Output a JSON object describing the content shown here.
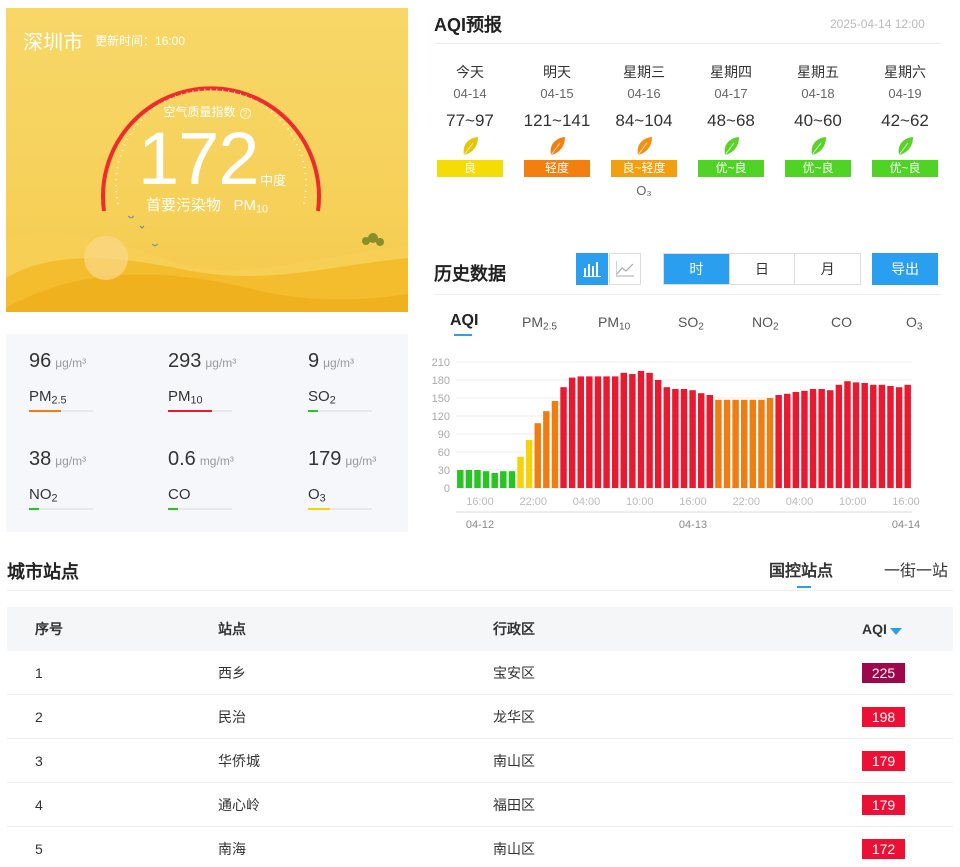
{
  "hero": {
    "city": "深圳市",
    "update_label": "更新时间：16:00",
    "aqi_label": "空气质量指数",
    "aqi_value": "172",
    "level": "中度",
    "primary_label": "首要污染物",
    "primary_pollutant": "PM",
    "primary_pollutant_sub": "10"
  },
  "pollutants": [
    {
      "value": "96",
      "unit": "μg/m³",
      "name": "PM",
      "sub": "2.5",
      "color": "#f07d12"
    },
    {
      "value": "293",
      "unit": "μg/m³",
      "name": "PM",
      "sub": "10",
      "color": "#e9192f"
    },
    {
      "value": "9",
      "unit": "μg/m³",
      "name": "SO",
      "sub": "2",
      "color": "#27c521"
    },
    {
      "value": "38",
      "unit": "μg/m³",
      "name": "NO",
      "sub": "2",
      "color": "#27c521"
    },
    {
      "value": "0.6",
      "unit": "mg/m³",
      "name": "CO",
      "sub": "",
      "color": "#27c521"
    },
    {
      "value": "179",
      "unit": "μg/m³",
      "name": "O",
      "sub": "3",
      "color": "#f5d20a"
    }
  ],
  "forecast": {
    "title": "AQI预报",
    "datetime": "2025-04-14 12:00",
    "days": [
      {
        "weekday": "今天",
        "date": "04-14",
        "range": "77~97",
        "badge": "良",
        "badge_color": "#f6dc06",
        "leaf": "#e8c406",
        "extra": ""
      },
      {
        "weekday": "明天",
        "date": "04-15",
        "range": "121~141",
        "badge": "轻度",
        "badge_color": "#f3800e",
        "leaf": "#f3800e",
        "extra": ""
      },
      {
        "weekday": "星期三",
        "date": "04-16",
        "range": "84~104",
        "badge": "良~轻度",
        "badge_color": "#f3a00e",
        "leaf": "#f3900e",
        "extra": "O₃"
      },
      {
        "weekday": "星期四",
        "date": "04-17",
        "range": "48~68",
        "badge": "优~良",
        "badge_color": "#4fd324",
        "leaf": "#5ad22a",
        "extra": ""
      },
      {
        "weekday": "星期五",
        "date": "04-18",
        "range": "40~60",
        "badge": "优~良",
        "badge_color": "#4fd324",
        "leaf": "#5ad22a",
        "extra": ""
      },
      {
        "weekday": "星期六",
        "date": "04-19",
        "range": "42~62",
        "badge": "优~良",
        "badge_color": "#4fd324",
        "leaf": "#5ad22a",
        "extra": ""
      }
    ]
  },
  "history": {
    "title": "历史数据",
    "periods": [
      "时",
      "日",
      "月"
    ],
    "export_label": "导出",
    "tabs": [
      {
        "name": "AQI",
        "sub": ""
      },
      {
        "name": "PM",
        "sub": "2.5"
      },
      {
        "name": "PM",
        "sub": "10"
      },
      {
        "name": "SO",
        "sub": "2"
      },
      {
        "name": "NO",
        "sub": "2"
      },
      {
        "name": "CO",
        "sub": ""
      },
      {
        "name": "O",
        "sub": "3"
      }
    ]
  },
  "chart_data": {
    "type": "bar",
    "ylim": [
      0,
      210
    ],
    "yticks": [
      0,
      30,
      60,
      90,
      120,
      150,
      180,
      210
    ],
    "xtick_labels": [
      "16:00",
      "22:00",
      "04:00",
      "10:00",
      "16:00",
      "22:00",
      "04:00",
      "10:00",
      "16:00"
    ],
    "xdate_labels": [
      "04-12",
      "04-13",
      "04-14"
    ],
    "values": [
      30,
      30,
      30,
      28,
      25,
      28,
      28,
      52,
      80,
      108,
      128,
      145,
      168,
      184,
      186,
      186,
      186,
      186,
      186,
      192,
      190,
      195,
      192,
      180,
      168,
      165,
      165,
      163,
      158,
      155,
      147,
      147,
      147,
      147,
      147,
      147,
      150,
      155,
      157,
      160,
      162,
      165,
      165,
      163,
      172,
      178,
      176,
      175,
      172,
      172,
      170,
      168,
      172
    ],
    "colors": {
      "good": "#27c521",
      "moderate": "#f5d20a",
      "light": "#f07d12",
      "medium": "#e9192f"
    }
  },
  "stations": {
    "title": "城市站点",
    "tabs": [
      "国控站点",
      "一街一站"
    ],
    "headers": {
      "no": "序号",
      "site": "站点",
      "district": "行政区",
      "aqi": "AQI"
    },
    "rows": [
      {
        "no": "1",
        "site": "西乡",
        "district": "宝安区",
        "aqi": "225",
        "color": "#a0064c"
      },
      {
        "no": "2",
        "site": "民治",
        "district": "龙华区",
        "aqi": "198",
        "color": "#ec1134"
      },
      {
        "no": "3",
        "site": "华侨城",
        "district": "南山区",
        "aqi": "179",
        "color": "#ec1134"
      },
      {
        "no": "4",
        "site": "通心岭",
        "district": "福田区",
        "aqi": "179",
        "color": "#ec1134"
      },
      {
        "no": "5",
        "site": "南海",
        "district": "南山区",
        "aqi": "172",
        "color": "#ec1134"
      }
    ]
  }
}
